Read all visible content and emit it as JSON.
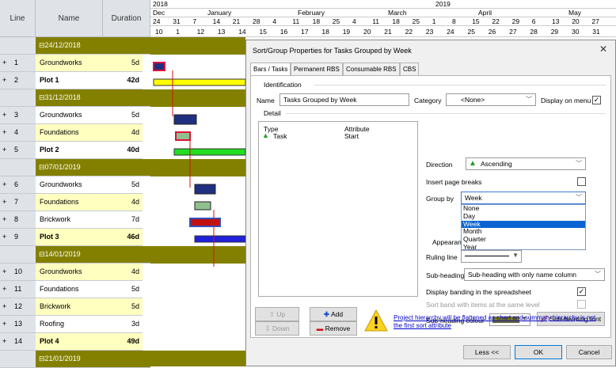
{
  "grid": {
    "headers": {
      "line": "Line",
      "name": "Name",
      "duration": "Duration"
    },
    "rows": [
      {
        "type": "group",
        "name": "24/12/2018"
      },
      {
        "type": "task",
        "line": "1",
        "name": "Groundworks",
        "duration": "5d",
        "yellow": true,
        "bold": false
      },
      {
        "type": "task",
        "line": "2",
        "name": "Plot 1",
        "duration": "42d",
        "yellow": false,
        "bold": true
      },
      {
        "type": "group",
        "name": "31/12/2018"
      },
      {
        "type": "task",
        "line": "3",
        "name": "Groundworks",
        "duration": "5d",
        "yellow": false,
        "bold": false
      },
      {
        "type": "task",
        "line": "4",
        "name": "Foundations",
        "duration": "4d",
        "yellow": true,
        "bold": false
      },
      {
        "type": "task",
        "line": "5",
        "name": "Plot 2",
        "duration": "40d",
        "yellow": false,
        "bold": true
      },
      {
        "type": "group",
        "name": "07/01/2019"
      },
      {
        "type": "task",
        "line": "6",
        "name": "Groundworks",
        "duration": "5d",
        "yellow": false,
        "bold": false
      },
      {
        "type": "task",
        "line": "7",
        "name": "Foundations",
        "duration": "4d",
        "yellow": true,
        "bold": false
      },
      {
        "type": "task",
        "line": "8",
        "name": "Brickwork",
        "duration": "7d",
        "yellow": false,
        "bold": false
      },
      {
        "type": "task",
        "line": "9",
        "name": "Plot 3",
        "duration": "46d",
        "yellow": true,
        "bold": true
      },
      {
        "type": "group",
        "name": "14/01/2019"
      },
      {
        "type": "task",
        "line": "10",
        "name": "Groundworks",
        "duration": "4d",
        "yellow": true,
        "bold": false
      },
      {
        "type": "task",
        "line": "11",
        "name": "Foundations",
        "duration": "5d",
        "yellow": false,
        "bold": false
      },
      {
        "type": "task",
        "line": "12",
        "name": "Brickwork",
        "duration": "5d",
        "yellow": true,
        "bold": false
      },
      {
        "type": "task",
        "line": "13",
        "name": "Roofing",
        "duration": "3d",
        "yellow": false,
        "bold": false
      },
      {
        "type": "task",
        "line": "14",
        "name": "Plot 4",
        "duration": "49d",
        "yellow": true,
        "bold": true
      },
      {
        "type": "group",
        "name": "21/01/2019"
      }
    ]
  },
  "timeline": {
    "years": [
      "2018",
      "2019"
    ],
    "months": [
      "Dec",
      "January",
      "February",
      "March",
      "April",
      "May"
    ],
    "dates": [
      "24",
      "31",
      "7",
      "14",
      "21",
      "28",
      "4",
      "11",
      "18",
      "25",
      "4",
      "11",
      "18",
      "25",
      "1",
      "8",
      "15",
      "22",
      "29",
      "6",
      "13",
      "20",
      "27"
    ],
    "weeks": [
      "10",
      "1",
      "12",
      "13",
      "14",
      "15",
      "16",
      "17",
      "18",
      "19",
      "20",
      "21",
      "22",
      "23",
      "24",
      "25",
      "26",
      "27",
      "28",
      "29",
      "30",
      "31"
    ]
  },
  "dialog": {
    "title": "Sort/Group Properties for Tasks Grouped by Week",
    "close": "✕",
    "tabs": [
      "Bars / Tasks",
      "Permanent RBS",
      "Consumable RBS",
      "CBS"
    ],
    "identification_label": "Identification",
    "name_label": "Name",
    "name_value": "Tasks Grouped by Week",
    "category_label": "Category",
    "category_value": "<None>",
    "display_on_menu_label": "Display on menu",
    "detail_label": "Detail",
    "detail_headers": {
      "type": "Type",
      "attribute": "Attribute"
    },
    "detail_row": {
      "type": "Task",
      "attribute": "Start"
    },
    "direction_label": "Direction",
    "direction_value": "Ascending",
    "insert_page_breaks_label": "Insert page breaks",
    "group_by_label": "Group by",
    "group_by_value": "Week",
    "group_by_options": [
      "None",
      "Day",
      "Week",
      "Month",
      "Quarter",
      "Year"
    ],
    "appearance_label": "Appearan",
    "ruling_line_label": "Ruling line",
    "subheading_label": "Sub-heading",
    "subheading_value": "Sub-heading with only name column",
    "display_banding_label": "Display banding in the spreadsheet",
    "sort_band_label": "Sort band with items at the same level",
    "subheading_colour_label": "Sub-heading colour",
    "subheading_font_button": "Sub-heading font",
    "up_button": "Up",
    "down_button": "Down",
    "add_button": "Add",
    "remove_button": "Remove",
    "warning_text": "Project hierarchy will be flattened as chart and summary hierarchy is not the first sort attribute",
    "less_button": "Less <<",
    "ok_button": "OK",
    "cancel_button": "Cancel",
    "colors": {
      "olive": "#838000",
      "selection": "#0a63d1"
    }
  }
}
